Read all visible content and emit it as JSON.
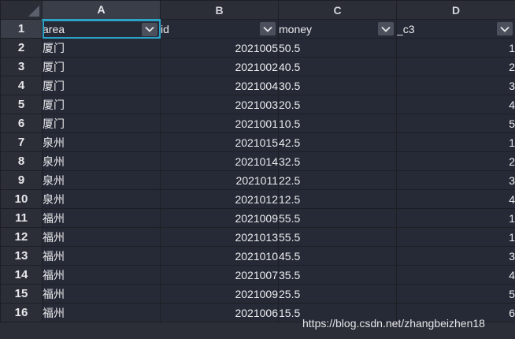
{
  "columns": [
    "A",
    "B",
    "C",
    "D"
  ],
  "header_row": {
    "row_number": "1",
    "cells": [
      "area",
      "id",
      "money",
      "_c3"
    ]
  },
  "rows": [
    {
      "row_number": "2",
      "area": "厦门",
      "id": "2021005",
      "money": "50.5",
      "c3": "1"
    },
    {
      "row_number": "3",
      "area": "厦门",
      "id": "2021002",
      "money": "40.5",
      "c3": "2"
    },
    {
      "row_number": "4",
      "area": "厦门",
      "id": "2021004",
      "money": "30.5",
      "c3": "3"
    },
    {
      "row_number": "5",
      "area": "厦门",
      "id": "2021003",
      "money": "20.5",
      "c3": "4"
    },
    {
      "row_number": "6",
      "area": "厦门",
      "id": "2021001",
      "money": "10.5",
      "c3": "5"
    },
    {
      "row_number": "7",
      "area": "泉州",
      "id": "2021015",
      "money": "42.5",
      "c3": "1"
    },
    {
      "row_number": "8",
      "area": "泉州",
      "id": "2021014",
      "money": "32.5",
      "c3": "2"
    },
    {
      "row_number": "9",
      "area": "泉州",
      "id": "2021011",
      "money": "22.5",
      "c3": "3"
    },
    {
      "row_number": "10",
      "area": "泉州",
      "id": "2021012",
      "money": "12.5",
      "c3": "4"
    },
    {
      "row_number": "11",
      "area": "福州",
      "id": "2021009",
      "money": "55.5",
      "c3": "1"
    },
    {
      "row_number": "12",
      "area": "福州",
      "id": "2021013",
      "money": "55.5",
      "c3": "1"
    },
    {
      "row_number": "13",
      "area": "福州",
      "id": "2021010",
      "money": "45.5",
      "c3": "3"
    },
    {
      "row_number": "14",
      "area": "福州",
      "id": "2021007",
      "money": "35.5",
      "c3": "4"
    },
    {
      "row_number": "15",
      "area": "福州",
      "id": "2021009",
      "money": "25.5",
      "c3": "5"
    },
    {
      "row_number": "16",
      "area": "福州",
      "id": "2021006",
      "money": "15.5",
      "c3": "6"
    }
  ],
  "watermark": "https://blog.csdn.net/zhangbeizhen18",
  "colors": {
    "accent": "#2aa3c7",
    "cell_bg": "#262a36",
    "header_bg": "#2b2e37"
  },
  "icons": {
    "filter": "chevron-down-icon",
    "corner": "select-all-triangle-icon"
  }
}
